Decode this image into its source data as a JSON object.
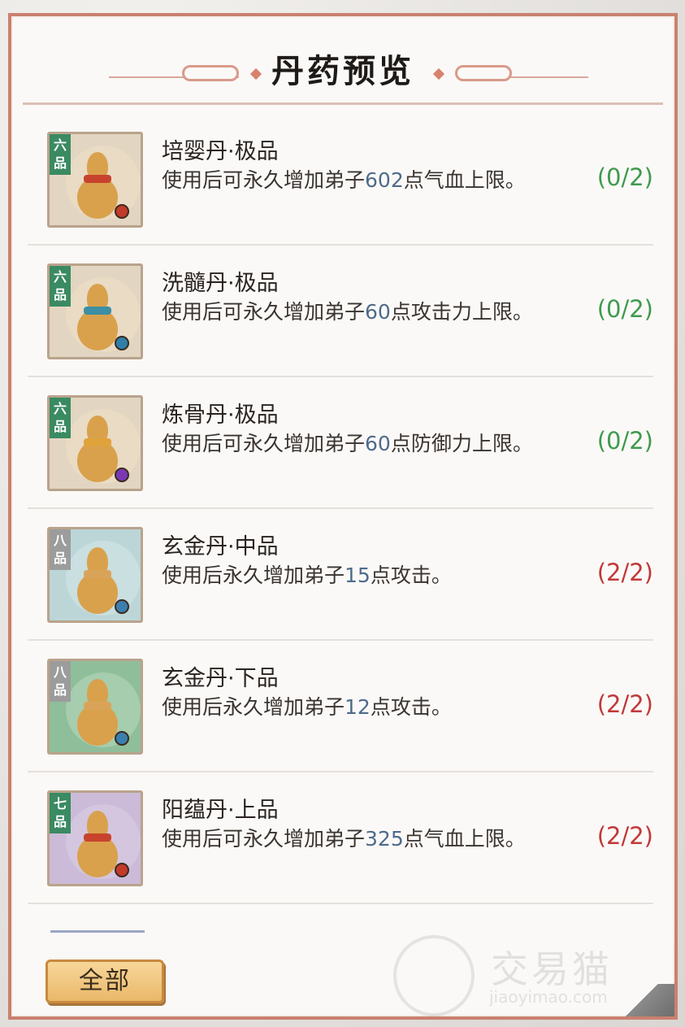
{
  "panel": {
    "title": "丹药预览"
  },
  "pills": [
    {
      "grade": "六品",
      "name": "培婴丹·极品",
      "desc_before": "使用后可永久增加弟子",
      "desc_value": "602",
      "desc_after": "点气血上限。",
      "count": "(0/2)",
      "count_color": "#3f9a4e",
      "frame_bg": "#e2d5c1",
      "glow_color": "#efe0c6",
      "tag_color": "#3a8a62",
      "scarf_color": "#c7432e",
      "bead_color": "#c23a2a"
    },
    {
      "grade": "六品",
      "name": "洗髓丹·极品",
      "desc_before": "使用后可永久增加弟子",
      "desc_value": "60",
      "desc_after": "点攻击力上限。",
      "count": "(0/2)",
      "count_color": "#3f9a4e",
      "frame_bg": "#e2d5c1",
      "glow_color": "#efe0c6",
      "tag_color": "#3a8a62",
      "scarf_color": "#3d8fa3",
      "bead_color": "#2f7fa8"
    },
    {
      "grade": "六品",
      "name": "炼骨丹·极品",
      "desc_before": "使用后可永久增加弟子",
      "desc_value": "60",
      "desc_after": "点防御力上限。",
      "count": "(0/2)",
      "count_color": "#3f9a4e",
      "frame_bg": "#e2d5c1",
      "glow_color": "#efe0c6",
      "tag_color": "#3a8a62",
      "scarf_color": "#e0a23a",
      "bead_color": "#7a38b5"
    },
    {
      "grade": "八品",
      "name": "玄金丹·中品",
      "desc_before": "使用后永久增加弟子",
      "desc_value": "15",
      "desc_after": "点攻击。",
      "count": "(2/2)",
      "count_color": "#c0393a",
      "frame_bg": "#bcd6d8",
      "glow_color": "#d4e7e8",
      "tag_color": "#9c9c9c",
      "scarf_color": "#d9a45a",
      "bead_color": "#3b7fb0"
    },
    {
      "grade": "八品",
      "name": "玄金丹·下品",
      "desc_before": "使用后永久增加弟子",
      "desc_value": "12",
      "desc_after": "点攻击。",
      "count": "(2/2)",
      "count_color": "#c0393a",
      "frame_bg": "#8fbe9a",
      "glow_color": "#b9d9bd",
      "tag_color": "#9c9c9c",
      "scarf_color": "#d9a45a",
      "bead_color": "#3b7fb0"
    },
    {
      "grade": "七品",
      "name": "阳蕴丹·上品",
      "desc_before": "使用后可永久增加弟子",
      "desc_value": "325",
      "desc_after": "点气血上限。",
      "count": "(2/2)",
      "count_color": "#c0393a",
      "frame_bg": "#cbbbd8",
      "glow_color": "#ddd0e6",
      "tag_color": "#3a8a62",
      "scarf_color": "#c7432e",
      "bead_color": "#c23a2a"
    }
  ],
  "footer": {
    "all_label": "全部"
  },
  "watermark": {
    "text": "交易猫",
    "sub": "jiaoyimao.com"
  }
}
